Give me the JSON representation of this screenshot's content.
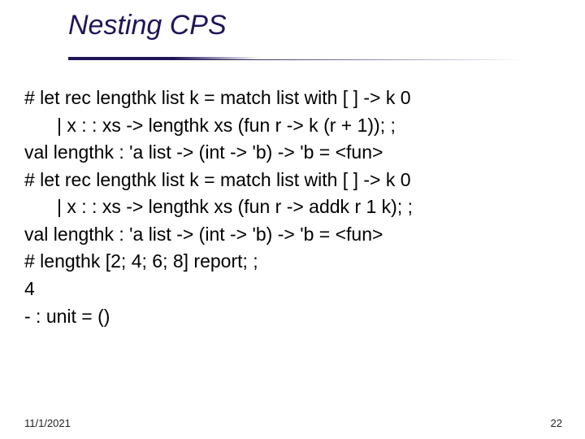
{
  "title": "Nesting CPS",
  "code_lines": [
    {
      "text": "# let rec lengthk list k = match list with [ ] -> k 0",
      "indent": 0
    },
    {
      "text": "| x : : xs -> lengthk xs (fun r -> k (r + 1)); ;",
      "indent": 1
    },
    {
      "text": "val lengthk : 'a list -> (int -> 'b) -> 'b = <fun>",
      "indent": 0
    },
    {
      "text": "# let rec lengthk list k = match list with [ ] -> k 0",
      "indent": 0
    },
    {
      "text": "| x : : xs -> lengthk xs (fun r -> addk r 1 k); ;",
      "indent": 1
    },
    {
      "text": "val lengthk : 'a list -> (int -> 'b) -> 'b = <fun>",
      "indent": 0
    },
    {
      "text": "# lengthk [2; 4; 6; 8] report; ;",
      "indent": 0
    },
    {
      "text": "4",
      "indent": 0
    },
    {
      "text": "- : unit = ()",
      "indent": 0
    }
  ],
  "footer": {
    "date": "11/1/2021",
    "page": "22"
  }
}
